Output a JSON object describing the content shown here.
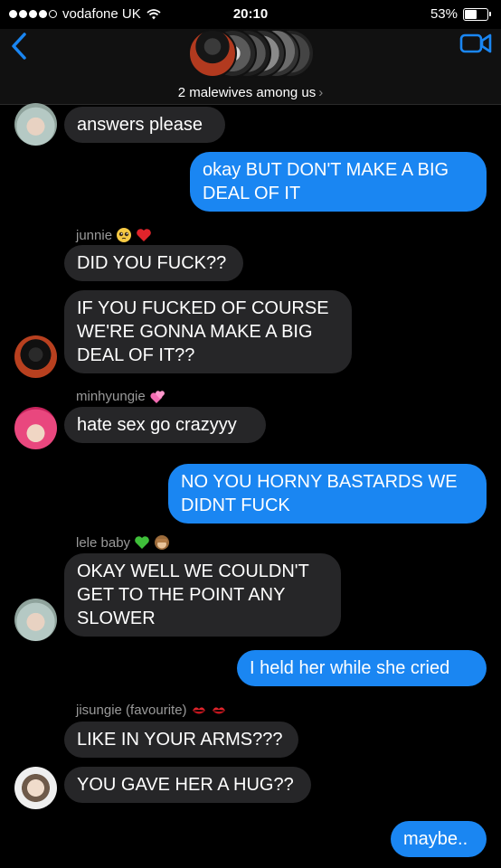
{
  "status": {
    "carrier": "vodafone UK",
    "time": "20:10",
    "battery": "53%",
    "battery_level": 0.53
  },
  "header": {
    "group_name": "2 malewives among us",
    "chevron": "›"
  },
  "messages": [
    {
      "dir": "in",
      "text": "answers please"
    },
    {
      "dir": "out",
      "text": "okay BUT DON'T MAKE A BIG DEAL OF IT"
    },
    {
      "dir": "in",
      "sender": "junnie",
      "text": "DID YOU FUCK??"
    },
    {
      "dir": "in",
      "text": "IF YOU FUCKED OF COURSE WE'RE GONNA MAKE A BIG DEAL OF IT??"
    },
    {
      "dir": "in",
      "sender": "minhyungie",
      "text": "hate sex go crazyyy"
    },
    {
      "dir": "out",
      "text": "NO YOU HORNY BASTARDS WE DIDNT FUCK"
    },
    {
      "dir": "in",
      "sender": "lele baby",
      "text": "OKAY WELL WE COULDN'T GET TO THE POINT ANY SLOWER"
    },
    {
      "dir": "out",
      "text": "I held her while she cried"
    },
    {
      "dir": "in",
      "sender": "jisungie (favourite)",
      "text": "LIKE IN YOUR ARMS???"
    },
    {
      "dir": "in",
      "text": "YOU GAVE HER A HUG??"
    },
    {
      "dir": "out",
      "text": "maybe.."
    }
  ],
  "colors": {
    "outgoing": "#1a86f2",
    "incoming": "#262628",
    "accent": "#1a86f2"
  }
}
